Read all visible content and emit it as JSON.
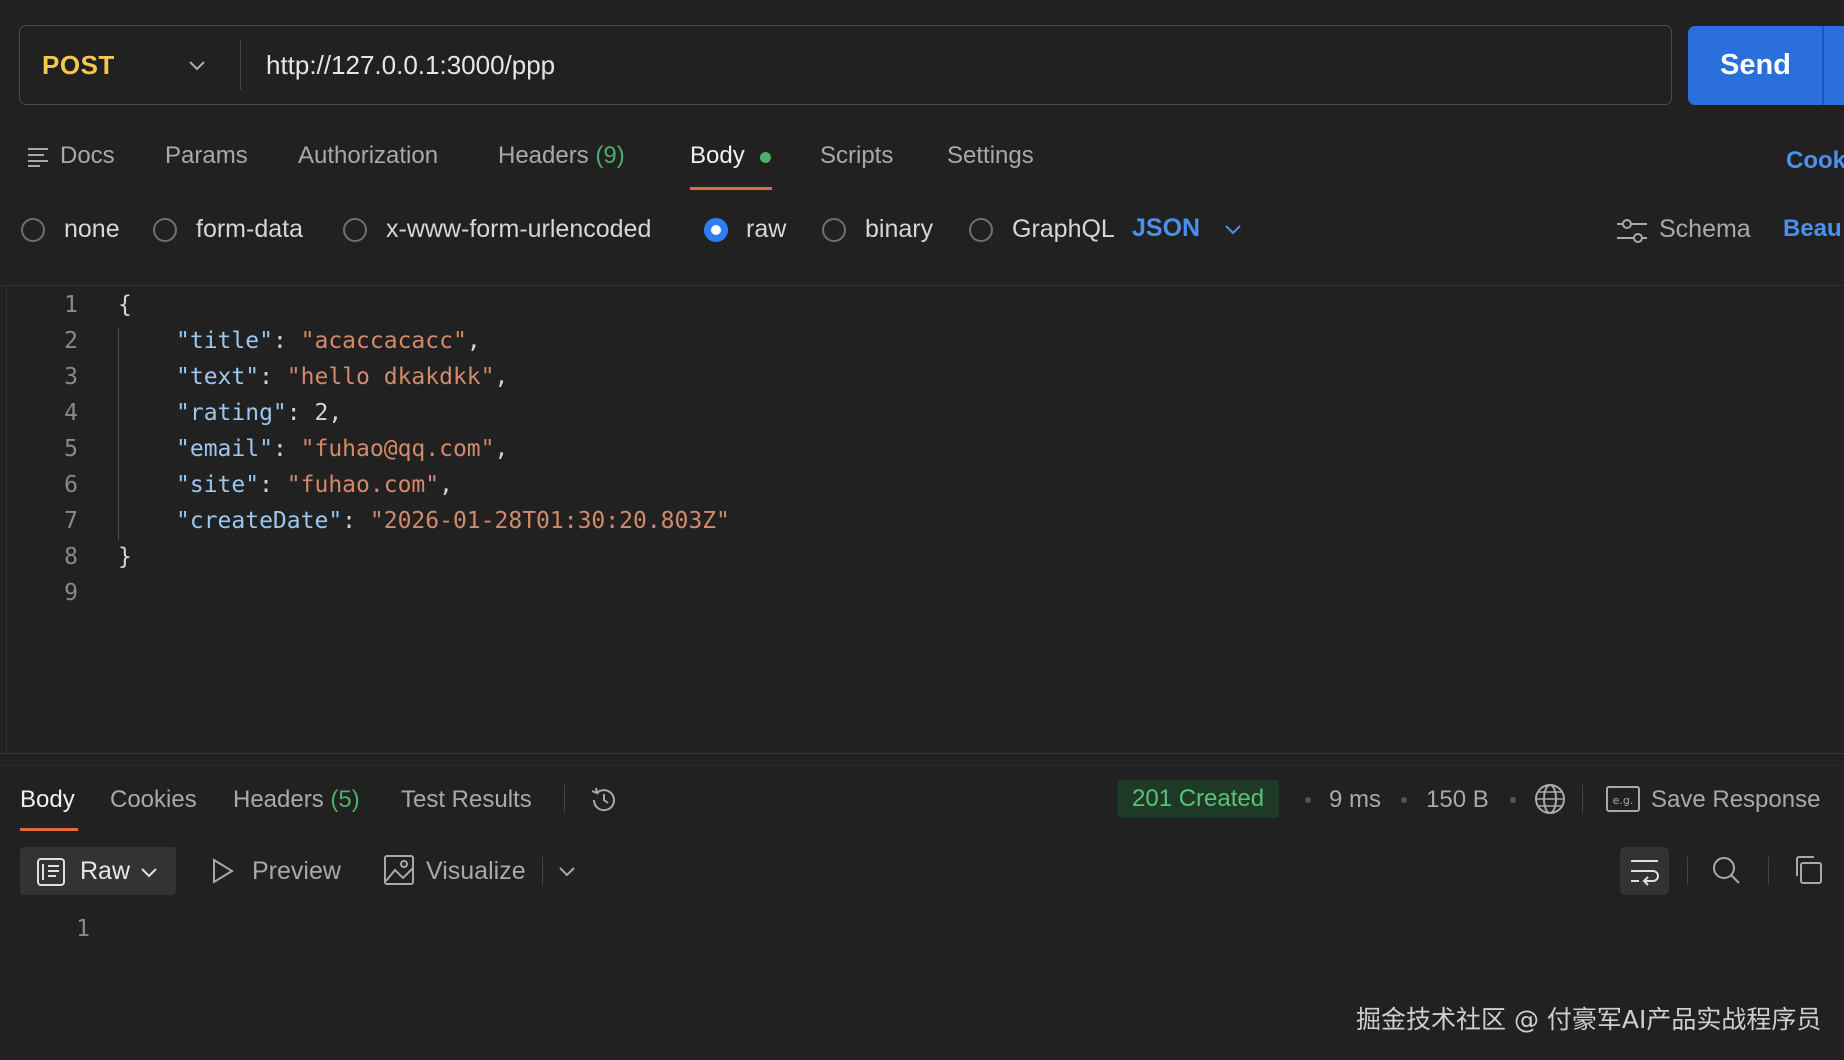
{
  "request": {
    "method": "POST",
    "url": "http://127.0.0.1:3000/ppp",
    "send_label": "Send"
  },
  "request_tabs": {
    "docs": "Docs",
    "params": "Params",
    "authorization": "Authorization",
    "headers": "Headers",
    "headers_count": "(9)",
    "body": "Body",
    "scripts": "Scripts",
    "settings": "Settings",
    "cookies_cut": "Cook"
  },
  "body_types": {
    "none": "none",
    "form_data": "form-data",
    "urlencoded": "x-www-form-urlencoded",
    "raw": "raw",
    "binary": "binary",
    "graphql": "GraphQL",
    "format": "JSON",
    "schema": "Schema",
    "beautify_cut": "Beau"
  },
  "editor": {
    "line_numbers": [
      "1",
      "2",
      "3",
      "4",
      "5",
      "6",
      "7",
      "8",
      "9"
    ],
    "open_brace": "{",
    "close_brace": "}",
    "fields": [
      {
        "key": "\"title\"",
        "sep": ": ",
        "value": "\"acaccacacc\"",
        "value_type": "string",
        "trail": ","
      },
      {
        "key": "\"text\"",
        "sep": ": ",
        "value": "\"hello dkakdkk\"",
        "value_type": "string",
        "trail": ","
      },
      {
        "key": "\"rating\"",
        "sep": ": ",
        "value": "2",
        "value_type": "number",
        "trail": ","
      },
      {
        "key": "\"email\"",
        "sep": ": ",
        "value": "\"fuhao@qq.com\"",
        "value_type": "string",
        "trail": ","
      },
      {
        "key": "\"site\"",
        "sep": ": ",
        "value": "\"fuhao.com\"",
        "value_type": "string",
        "trail": ","
      },
      {
        "key": "\"createDate\"",
        "sep": ": ",
        "value": "\"2026-01-28T01:30:20.803Z\"",
        "value_type": "string",
        "trail": ""
      }
    ]
  },
  "response": {
    "tabs": {
      "body": "Body",
      "cookies": "Cookies",
      "headers": "Headers",
      "headers_count": "(5)",
      "test_results": "Test Results"
    },
    "status": "201 Created",
    "time": "9 ms",
    "size": "150 B",
    "save_response": "Save Response",
    "eg_label": "e.g.",
    "view_mode": "Raw",
    "preview": "Preview",
    "visualize": "Visualize",
    "line_numbers": [
      "1"
    ]
  },
  "watermark": "掘金技术社区 @ 付豪军AI产品实战程序员",
  "colors": {
    "background": "#212121",
    "accent_blue": "#2a6fdc",
    "method_yellow": "#f2c94c",
    "tab_underline": "#e5683a",
    "status_green": "#59c27a",
    "json_key": "#9cc7ee",
    "json_string": "#d48a6a"
  }
}
